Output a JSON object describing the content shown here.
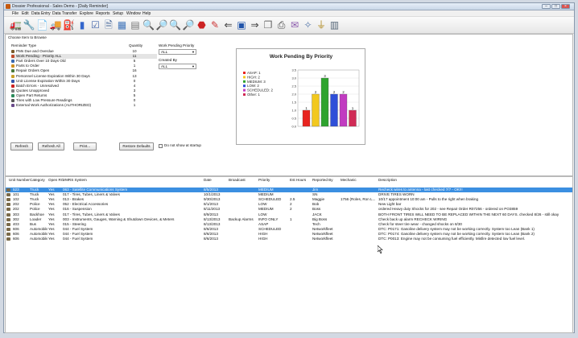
{
  "window": {
    "title": "Dossier Professional - Sales Demo - [Daily Reminder]"
  },
  "menu": [
    "File",
    "Edit",
    "Data Entry",
    "Data Transfer",
    "Explore",
    "Reports",
    "Setup",
    "Window",
    "Help"
  ],
  "toolbar": [
    {
      "name": "vehicles-icon",
      "glyph": "🚛",
      "color": "#6a5a2a"
    },
    {
      "name": "tools-icon",
      "glyph": "🔧",
      "color": "#3a7a3a"
    },
    {
      "name": "document-icon",
      "glyph": "📄",
      "color": "#c04040"
    },
    {
      "name": "truck-icon",
      "glyph": "🚚",
      "color": "#2244aa"
    },
    {
      "name": "fuel-icon",
      "glyph": "⛽",
      "color": "#228833"
    },
    {
      "name": "battery-icon",
      "glyph": "▮",
      "color": "#3366cc"
    },
    {
      "name": "checklist-icon",
      "glyph": "☑",
      "color": "#4466aa"
    },
    {
      "name": "forms-icon",
      "glyph": "🗎",
      "color": "#446699"
    },
    {
      "name": "calendar-icon",
      "glyph": "▦",
      "color": "#4477bb"
    },
    {
      "name": "calculator-icon",
      "glyph": "▤",
      "color": "#777777"
    },
    {
      "name": "magnify-icon",
      "glyph": "🔍",
      "color": "#335599"
    },
    {
      "name": "magnify-plus-icon",
      "glyph": "🔎",
      "color": "#335599"
    },
    {
      "name": "magnify-minus-icon",
      "glyph": "🔍",
      "color": "#335599"
    },
    {
      "name": "search-globe-icon",
      "glyph": "🔎",
      "color": "#2277aa"
    },
    {
      "name": "stop-icon",
      "glyph": "⬣",
      "color": "#cc2222"
    },
    {
      "name": "pencil-icon",
      "glyph": "✎",
      "color": "#cc3333"
    },
    {
      "name": "arrow-left-icon",
      "glyph": "⇐",
      "color": "#333333"
    },
    {
      "name": "save-icon",
      "glyph": "▣",
      "color": "#2255aa"
    },
    {
      "name": "arrow-right-icon",
      "glyph": "⇒",
      "color": "#333333"
    },
    {
      "name": "pages-icon",
      "glyph": "❐",
      "color": "#666666"
    },
    {
      "name": "print-icon",
      "glyph": "⎙",
      "color": "#444444"
    },
    {
      "name": "mail-icon",
      "glyph": "✉",
      "color": "#8855aa"
    },
    {
      "name": "wizard-icon",
      "glyph": "✧",
      "color": "#5577aa"
    },
    {
      "name": "plug-icon",
      "glyph": "⏚",
      "color": "#b08a20"
    },
    {
      "name": "report-icon",
      "glyph": "▥",
      "color": "#556677"
    }
  ],
  "browse": {
    "choose_label": "Choose Item to Browse",
    "col_reminder": "Reminder Type",
    "col_qty": "Quantity",
    "reminders": [
      {
        "label": "PMs Due and Overdue",
        "qty": "10",
        "icon": "#7a5a2a"
      },
      {
        "label": "Work Pending - Priority ALL",
        "qty": "11",
        "icon": "#c04a2a"
      },
      {
        "label": "Part Orders Over 10 Days Old",
        "qty": "5",
        "icon": "#3a6ab0"
      },
      {
        "label": "Parts to Order",
        "qty": "1",
        "icon": "#d09020"
      },
      {
        "label": "Repair Orders Open",
        "qty": "16",
        "icon": "#4a7a3a"
      },
      {
        "label": "Personnel License Expiration Within 30 Days",
        "qty": "13",
        "icon": "#c9a028"
      },
      {
        "label": "Unit License Expiration Within 30 Days",
        "qty": "0",
        "icon": "#3355aa"
      },
      {
        "label": "Batch Errors - Unresolved",
        "qty": "4",
        "icon": "#cc2222"
      },
      {
        "label": "Quotes Unapproved",
        "qty": "3",
        "icon": "#7a7a7a"
      },
      {
        "label": "Open Part Returns",
        "qty": "5",
        "icon": "#2a8a5a"
      },
      {
        "label": "Tires with Low Pressure Readings",
        "qty": "0",
        "icon": "#555555"
      },
      {
        "label": "External Work Authorizations (AUTHORIZED)",
        "qty": "1",
        "icon": "#6a4a8a"
      }
    ],
    "work_pending_label": "Work Pending Priority",
    "work_pending_value": "ALL",
    "created_by_label": "Created By",
    "created_by_value": "ALL",
    "refresh": "Refresh",
    "refresh_all": "Refresh All",
    "print": "Print...",
    "restore": "Restore Defaults",
    "dont_show": "Do not show at startup"
  },
  "chart_data": {
    "type": "bar",
    "title": "Work Pending By Priority",
    "categories": [
      "ASAP",
      "HIGH",
      "MEDIUM",
      "LOW",
      "SCHEDULED",
      "Other"
    ],
    "legend": [
      "ASAP: 1",
      "HIGH: 2",
      "MEDIUM: 3",
      "LOW: 2",
      "SCHEDULED: 2",
      "Other: 1"
    ],
    "values": [
      1,
      2,
      3,
      2,
      2,
      1
    ],
    "colors": [
      "#e8241f",
      "#f2c81e",
      "#2ea32e",
      "#2f4fd8",
      "#c13bc1",
      "#d02a55"
    ],
    "ylim": [
      0,
      3.5
    ],
    "yticks": [
      "0.0",
      "0.5",
      "1.0",
      "1.5",
      "2.0",
      "2.5",
      "3.0",
      "3.5"
    ],
    "grid": true,
    "legend_position": "left"
  },
  "grid": {
    "headers": [
      "Unit Number",
      "Category",
      "Open RO",
      "VMRS System",
      "Date",
      "Broadcast",
      "Priority",
      "Est Hours",
      "Reported By",
      "Mechanic",
      "Description"
    ],
    "rows": [
      [
        "523",
        "Truck",
        "Yes",
        "063 - Satellite Communications System",
        "8/5/2013",
        "",
        "MEDIUM",
        "",
        "Jim",
        "",
        "Recheck wires to antenna - last checked 7/7 - OK!!!"
      ],
      [
        "101",
        "Truck",
        "Yes",
        "017 - Tires, Tubes, Liners & Valves",
        "10/1/2013",
        "",
        "MEDIUM",
        "",
        "SN",
        "",
        "DRIVE TIRES WORN"
      ],
      [
        "102",
        "Truck",
        "Yes",
        "013 - Brakes",
        "9/30/2013",
        "",
        "SCHEDULED",
        "2.5",
        "Maggie",
        "1756 (Roles, Ron L...",
        "10/17 appointment 10:00 am - Pulls to the right when braking"
      ],
      [
        "202",
        "Police",
        "Yes",
        "052 - Electrical Accessories",
        "8/1/2013",
        "",
        "LOW",
        "2",
        "Bob",
        "",
        "New Light bar"
      ],
      [
        "202",
        "Police",
        "Yes",
        "016 - Suspension",
        "8/11/2013",
        "",
        "MEDIUM",
        "2",
        "Boss",
        "",
        "ordered Heavy duty Shocks for 202 - see Repair Order R07256 - ordered on PO3859"
      ],
      [
        "303",
        "Backhoe",
        "Yes",
        "017 - Tires, Tubes, Liners & Valves",
        "8/9/2013",
        "",
        "LOW",
        "",
        "JACK",
        "",
        "BOTH FRONT TIRES WILL NEED TO BE REPLACED WITHIN THE NEXT 60 DAYS. checked 8/26 - still okay"
      ],
      [
        "302",
        "Loader",
        "Yes",
        "003 - Instruments, Gauges, Warning & Shutdown Devices, & Meters",
        "8/13/2013",
        "Backup Alarms",
        "INFO ONLY",
        "1",
        "Big Boss",
        "",
        "Check back up alarm RECHECK WIRING"
      ],
      [
        "403",
        "Bus",
        "Yes",
        "015 - Steering",
        "8/13/2013",
        "",
        "ASAP",
        "",
        "Tech",
        "",
        "Check for steer tire wear - changed shocks on 8/30"
      ],
      [
        "606",
        "Automobile",
        "Yes",
        "044 - Fuel System",
        "8/6/2013",
        "",
        "SCHEDULED",
        "",
        "Networkfleet",
        "",
        "DTC: P0171: Gasoline delivery system may not be working correctly. System too Lean (Bank 1)"
      ],
      [
        "606",
        "Automobile",
        "Yes",
        "044 - Fuel System",
        "8/6/2013",
        "",
        "HIGH",
        "",
        "Networkfleet",
        "",
        "DTC: P0174: Gasoline delivery system may not be working correctly. System too Lean (Bank 2)"
      ],
      [
        "606",
        "Automobile",
        "Yes",
        "044 - Fuel System",
        "8/6/2013",
        "",
        "HIGH",
        "",
        "Networkfleet",
        "",
        "DTC: P0013: Engine may not be consuming fuel efficiently. Misfire detected low fuel level."
      ]
    ]
  }
}
